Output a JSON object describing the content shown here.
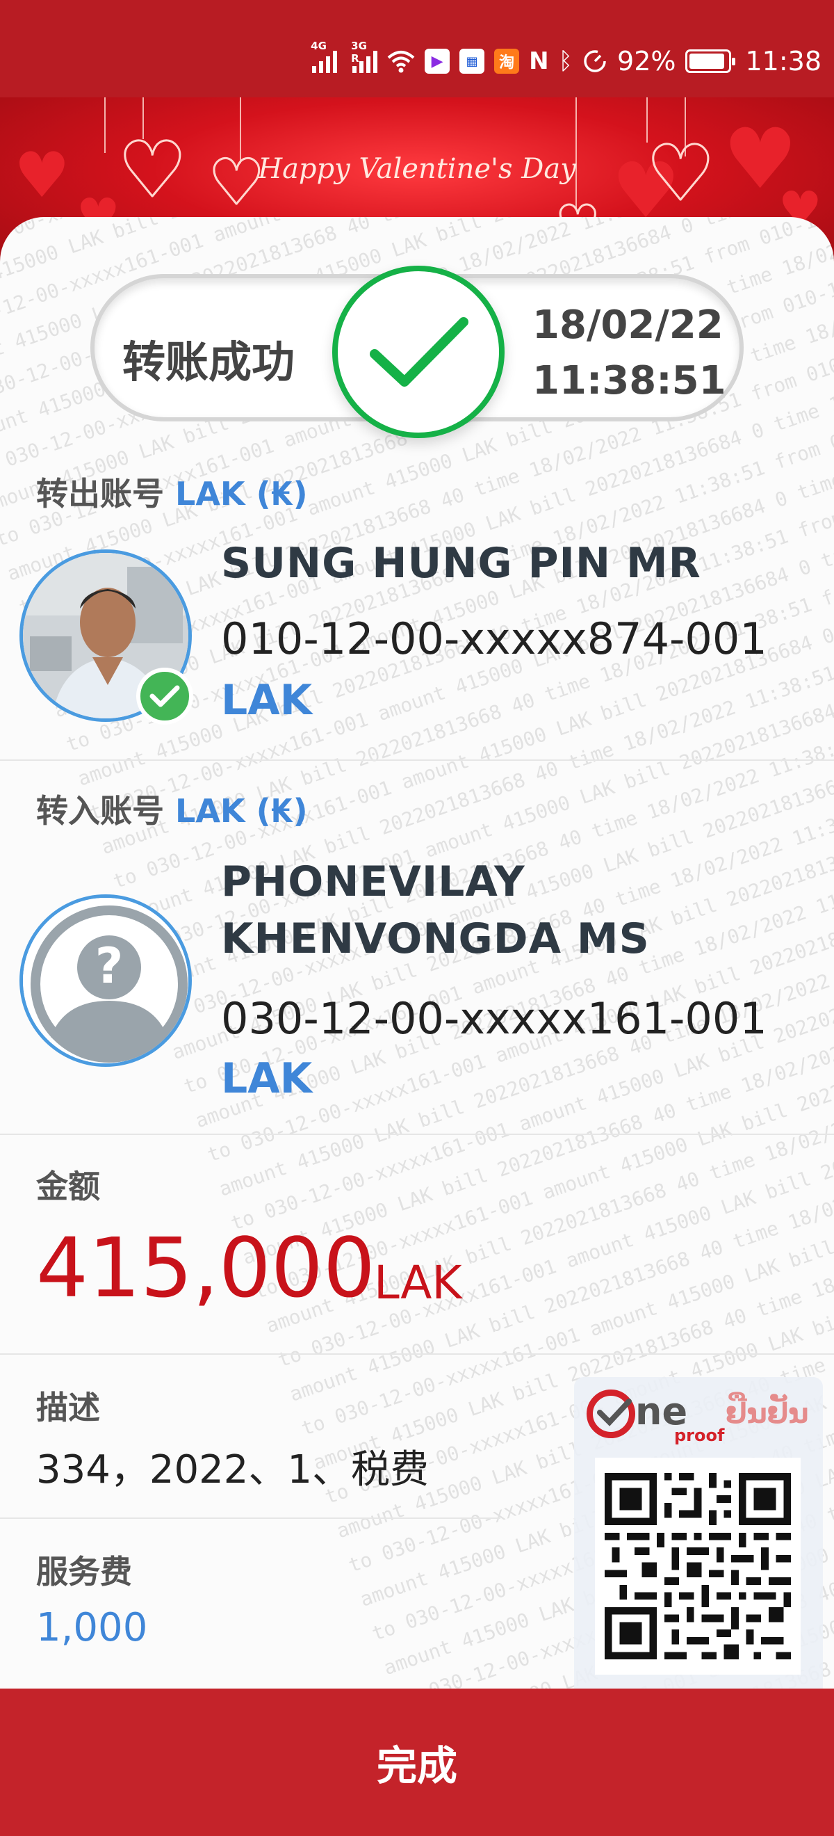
{
  "status_bar": {
    "net1": "4G",
    "net2": "3G R",
    "battery": "92%",
    "time": "11:38"
  },
  "banner": {
    "title": "Happy Valentine's Day"
  },
  "result": {
    "status": "转账成功",
    "date": "18/02/22",
    "time": "11:38:51"
  },
  "from": {
    "label": "转出账号",
    "currency": "LAK (₭)",
    "name": "SUNG HUNG PIN MR",
    "account": "010-12-00-xxxxx874-001",
    "account_currency": "LAK"
  },
  "to": {
    "label": "转入账号",
    "currency": "LAK (₭)",
    "name_line1": "PHONEVILAY",
    "name_line2": "KHENVONGDA MS",
    "account": "030-12-00-xxxxx161-001",
    "account_currency": "LAK"
  },
  "amount": {
    "label": "金额",
    "value": "415,000",
    "currency": "LAK"
  },
  "description": {
    "label": "描述",
    "value": "334，2022、1、税费"
  },
  "fee": {
    "label": "服务费",
    "value": "1,000"
  },
  "oneproof": {
    "logo": "ne",
    "logo_sub": "proof",
    "lao_text": "ຢືນຢັນ"
  },
  "watermark_lines": [
    "amount 415000 LAK bill 2022021813668 40 time 18/02/2022 11:38:51 from 010-12-00-xxxxx874-001 to 030-12-00-xxxxx161-001",
    "to 030-12-00-xxxxx161-001 amount 415000 LAK bill 20220218136684 0 time 18/02/2022 11:38:51 from 010-12-00-xxxxx874-001"
  ],
  "done_button": "完成"
}
